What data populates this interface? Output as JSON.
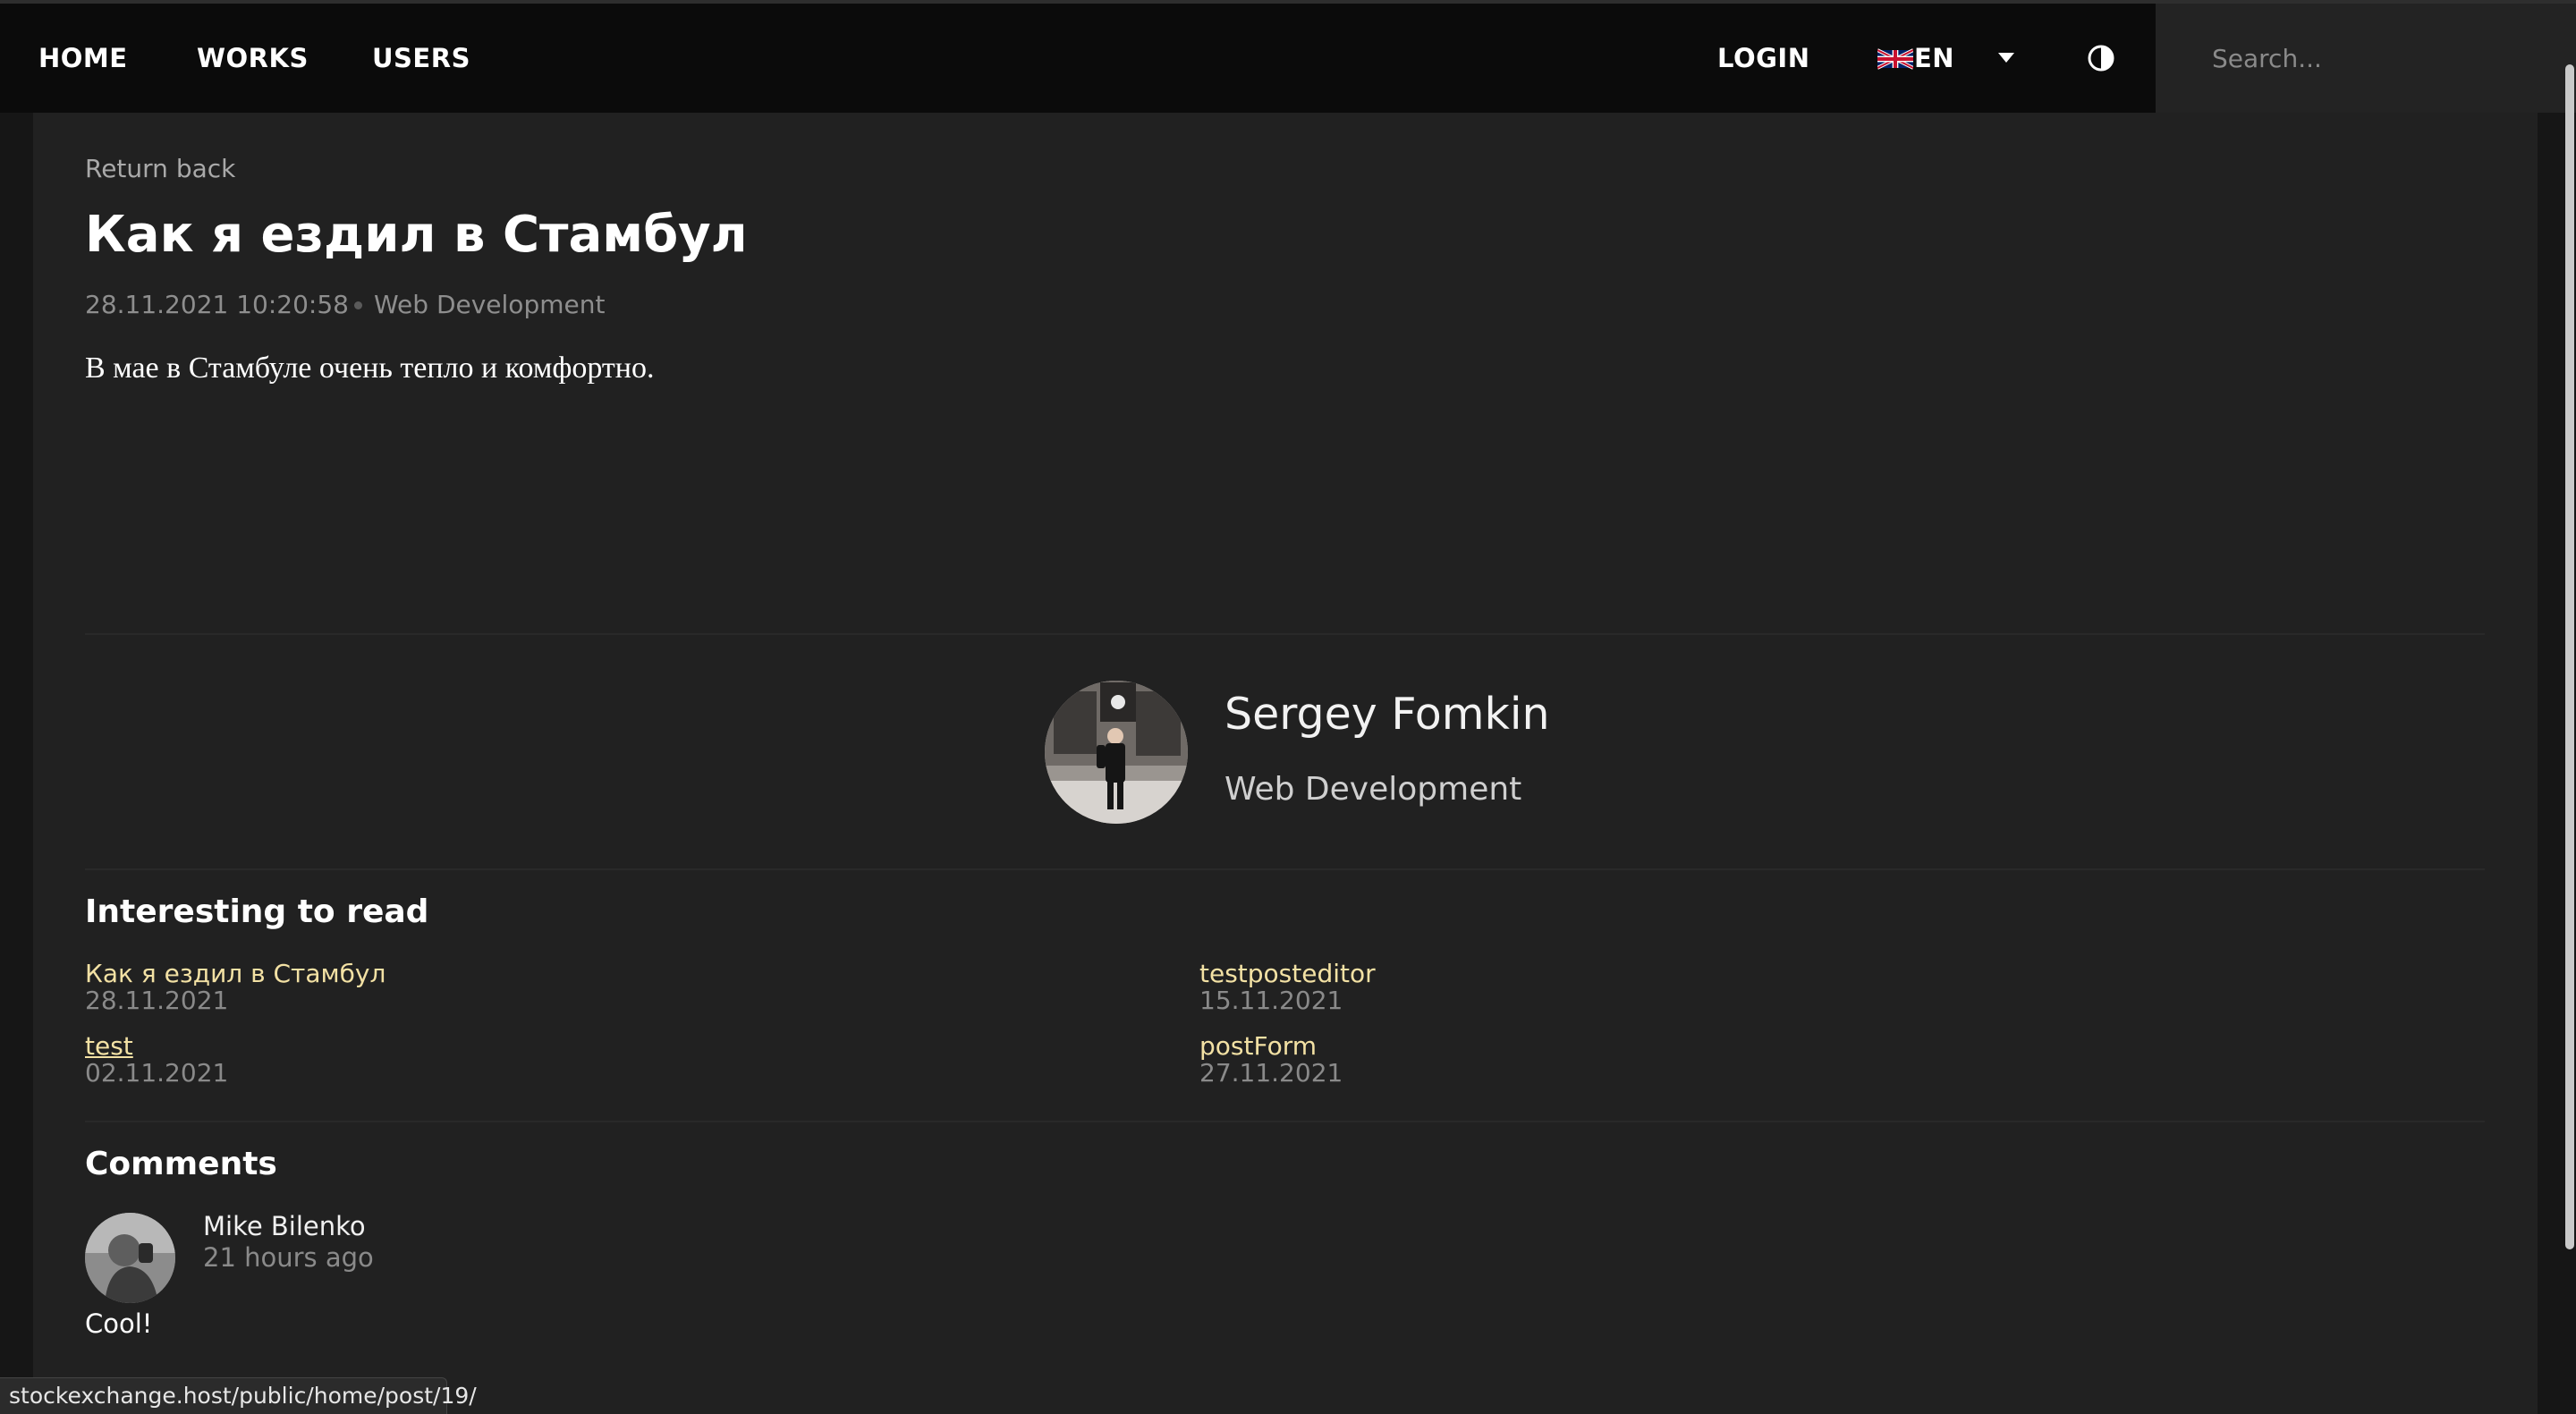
{
  "nav": {
    "links": [
      "HOME",
      "WORKS",
      "USERS"
    ],
    "login": "LOGIN",
    "language": "EN",
    "search_placeholder": "Search..."
  },
  "post": {
    "return_label": "Return back",
    "title": "Как я ездил в Стамбул",
    "datetime": "28.11.2021 10:20:58",
    "category": "Web Development",
    "body": "В мае в Стамбуле очень тепло и комфортно."
  },
  "author": {
    "name": "Sergey Fomkin",
    "role": "Web Development"
  },
  "interesting": {
    "title": "Interesting to read",
    "items": [
      {
        "title": "Как я ездил в Стамбул",
        "date": "28.11.2021"
      },
      {
        "title": "testposteditor",
        "date": "15.11.2021"
      },
      {
        "title": "test",
        "date": "02.11.2021"
      },
      {
        "title": "postForm",
        "date": "27.11.2021"
      }
    ]
  },
  "comments": {
    "title": "Comments",
    "items": [
      {
        "author": "Mike Bilenko",
        "time": "21 hours ago",
        "text": "Cool!"
      }
    ]
  },
  "status_bar": {
    "url": "stockexchange.host/public/home/post/19/"
  },
  "icons": {
    "language_flag": "uk-flag-icon",
    "language_dropdown": "caret-down-icon",
    "theme_toggle": "contrast-icon"
  },
  "colors": {
    "background": "#1a1a1a",
    "navbar": "#0b0b0b",
    "card": "#212121",
    "link_accent": "#f3e1a4",
    "muted_text": "#8e8e8e"
  }
}
